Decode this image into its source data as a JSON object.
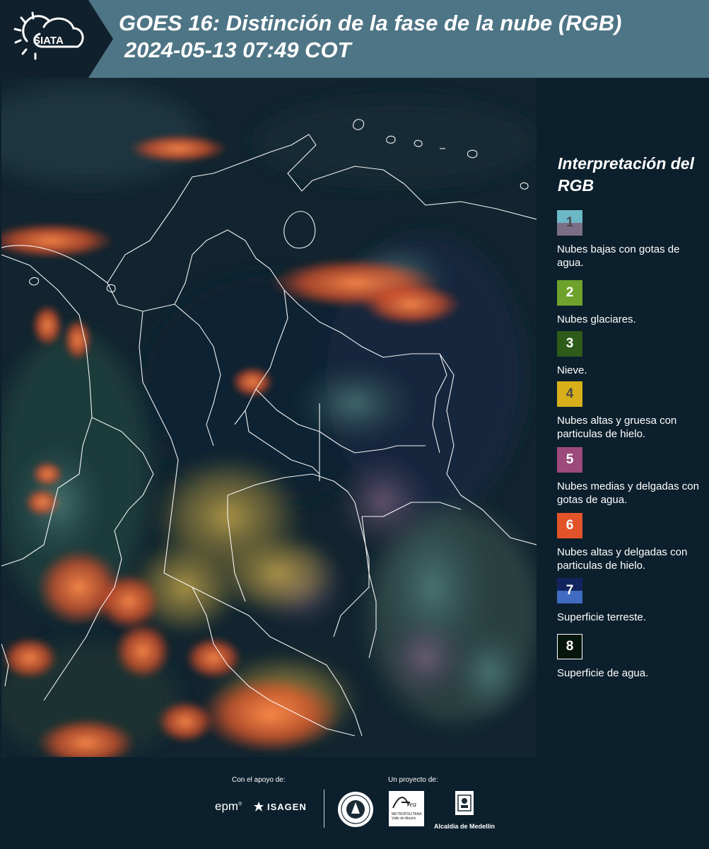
{
  "header": {
    "title_line1": "GOES 16: Distinción de la fase de la nube (RGB)",
    "title_line2": "2024-05-13 07:49 COT",
    "logo_text": "SIATA",
    "background_color": "#4e7585"
  },
  "legend": {
    "title": "Interpretación del RGB",
    "items": [
      {
        "number": "1",
        "label": "Nubes bajas con gotas de agua.",
        "color_top": "#6db8c6",
        "color_bottom": "#7b6f88",
        "number_color": "#4a4a4a"
      },
      {
        "number": "2",
        "label": "Nubes glaciares.",
        "color_top": "#6ea22c",
        "color_bottom": "#6ea22c",
        "number_color": "#ffffff"
      },
      {
        "number": "3",
        "label": "Nieve.",
        "color_top": "#2e5a1a",
        "color_bottom": "#2e5a1a",
        "number_color": "#ffffff"
      },
      {
        "number": "4",
        "label": "Nubes altas y gruesa con particulas de hielo.",
        "color_top": "#d7b019",
        "color_bottom": "#d7b019",
        "number_color": "#4a4a4a"
      },
      {
        "number": "5",
        "label": "Nubes medias y delgadas con gotas de agua.",
        "color_top": "#9c4a7b",
        "color_bottom": "#9c4a7b",
        "number_color": "#ffffff"
      },
      {
        "number": "6",
        "label": "Nubes altas y delgadas con particulas de hielo.",
        "color_top": "#e2532a",
        "color_bottom": "#e2532a",
        "number_color": "#ffffff"
      },
      {
        "number": "7",
        "label": "Superficie terreste.",
        "color_top": "#12245f",
        "color_bottom": "#3f6cc0",
        "number_color": "#ffffff"
      },
      {
        "number": "8",
        "label": "Superficie de agua.",
        "color_top": "#07160d",
        "color_bottom": "#07160d",
        "number_color": "#ffffff"
      }
    ]
  },
  "footer": {
    "support_label": "Con el apoyo de:",
    "project_label": "Un proyecto de:",
    "sponsors": [
      "epm",
      "ISAGEN"
    ],
    "partners": [
      "Universidad Nacional de Colombia",
      "Área Metropolitana Valle de Aburrá",
      "Alcaldía de Medellín"
    ],
    "amva_text": "METROPOLITANA Valle de Aburrá",
    "alcaldia_text": "Alcaldía de Medellín"
  }
}
